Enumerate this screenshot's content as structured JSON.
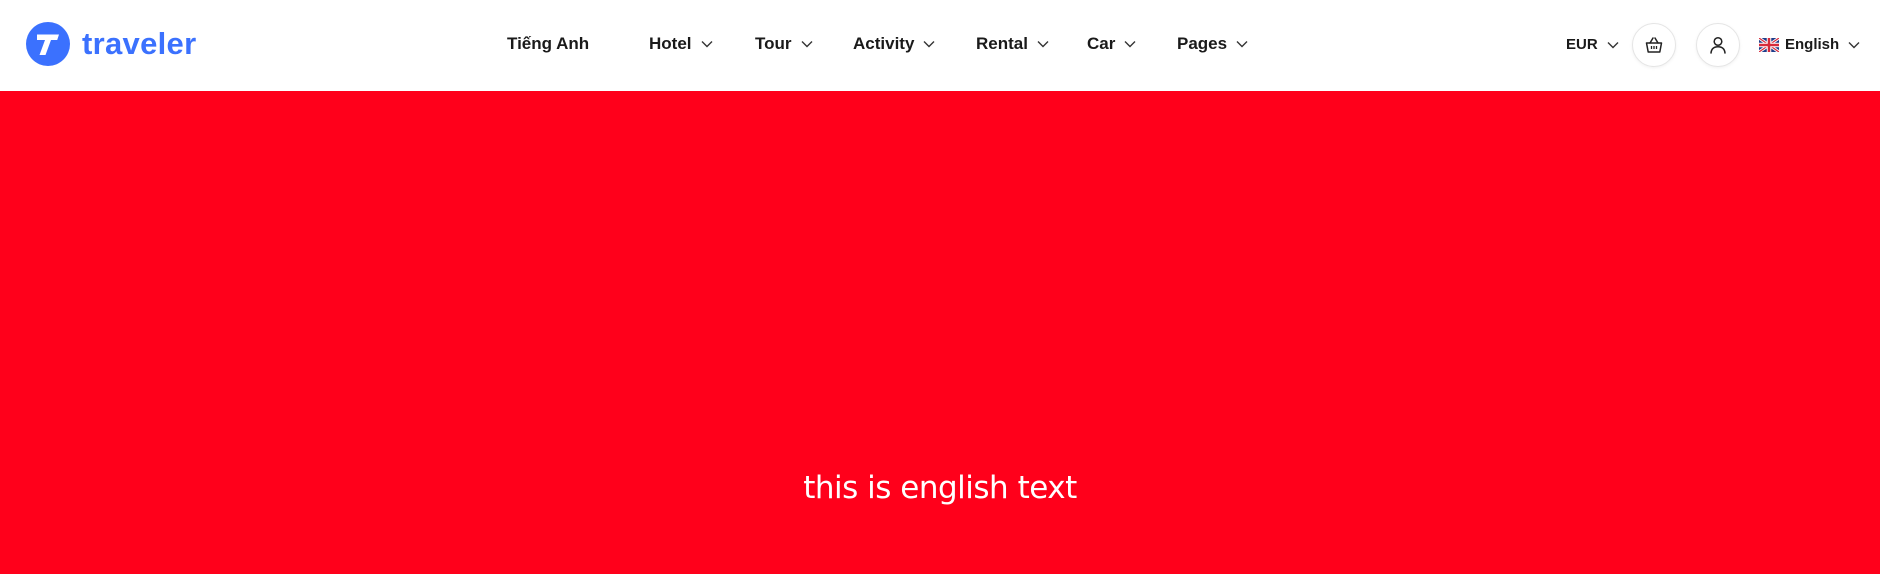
{
  "brand": {
    "name": "traveler",
    "color": "#3b71fe"
  },
  "nav": {
    "items": [
      {
        "label": "Tiếng Anh",
        "has_dropdown": false
      },
      {
        "label": "Hotel",
        "has_dropdown": true
      },
      {
        "label": "Tour",
        "has_dropdown": true
      },
      {
        "label": "Activity",
        "has_dropdown": true
      },
      {
        "label": "Rental",
        "has_dropdown": true
      },
      {
        "label": "Car",
        "has_dropdown": true
      },
      {
        "label": "Pages",
        "has_dropdown": true
      }
    ]
  },
  "tools": {
    "currency": "EUR",
    "cart_icon": "basket-icon",
    "account_icon": "user-icon",
    "language": "English",
    "language_flag": "uk-flag-icon"
  },
  "hero": {
    "background": "#ff001b",
    "text": "this is english text"
  }
}
